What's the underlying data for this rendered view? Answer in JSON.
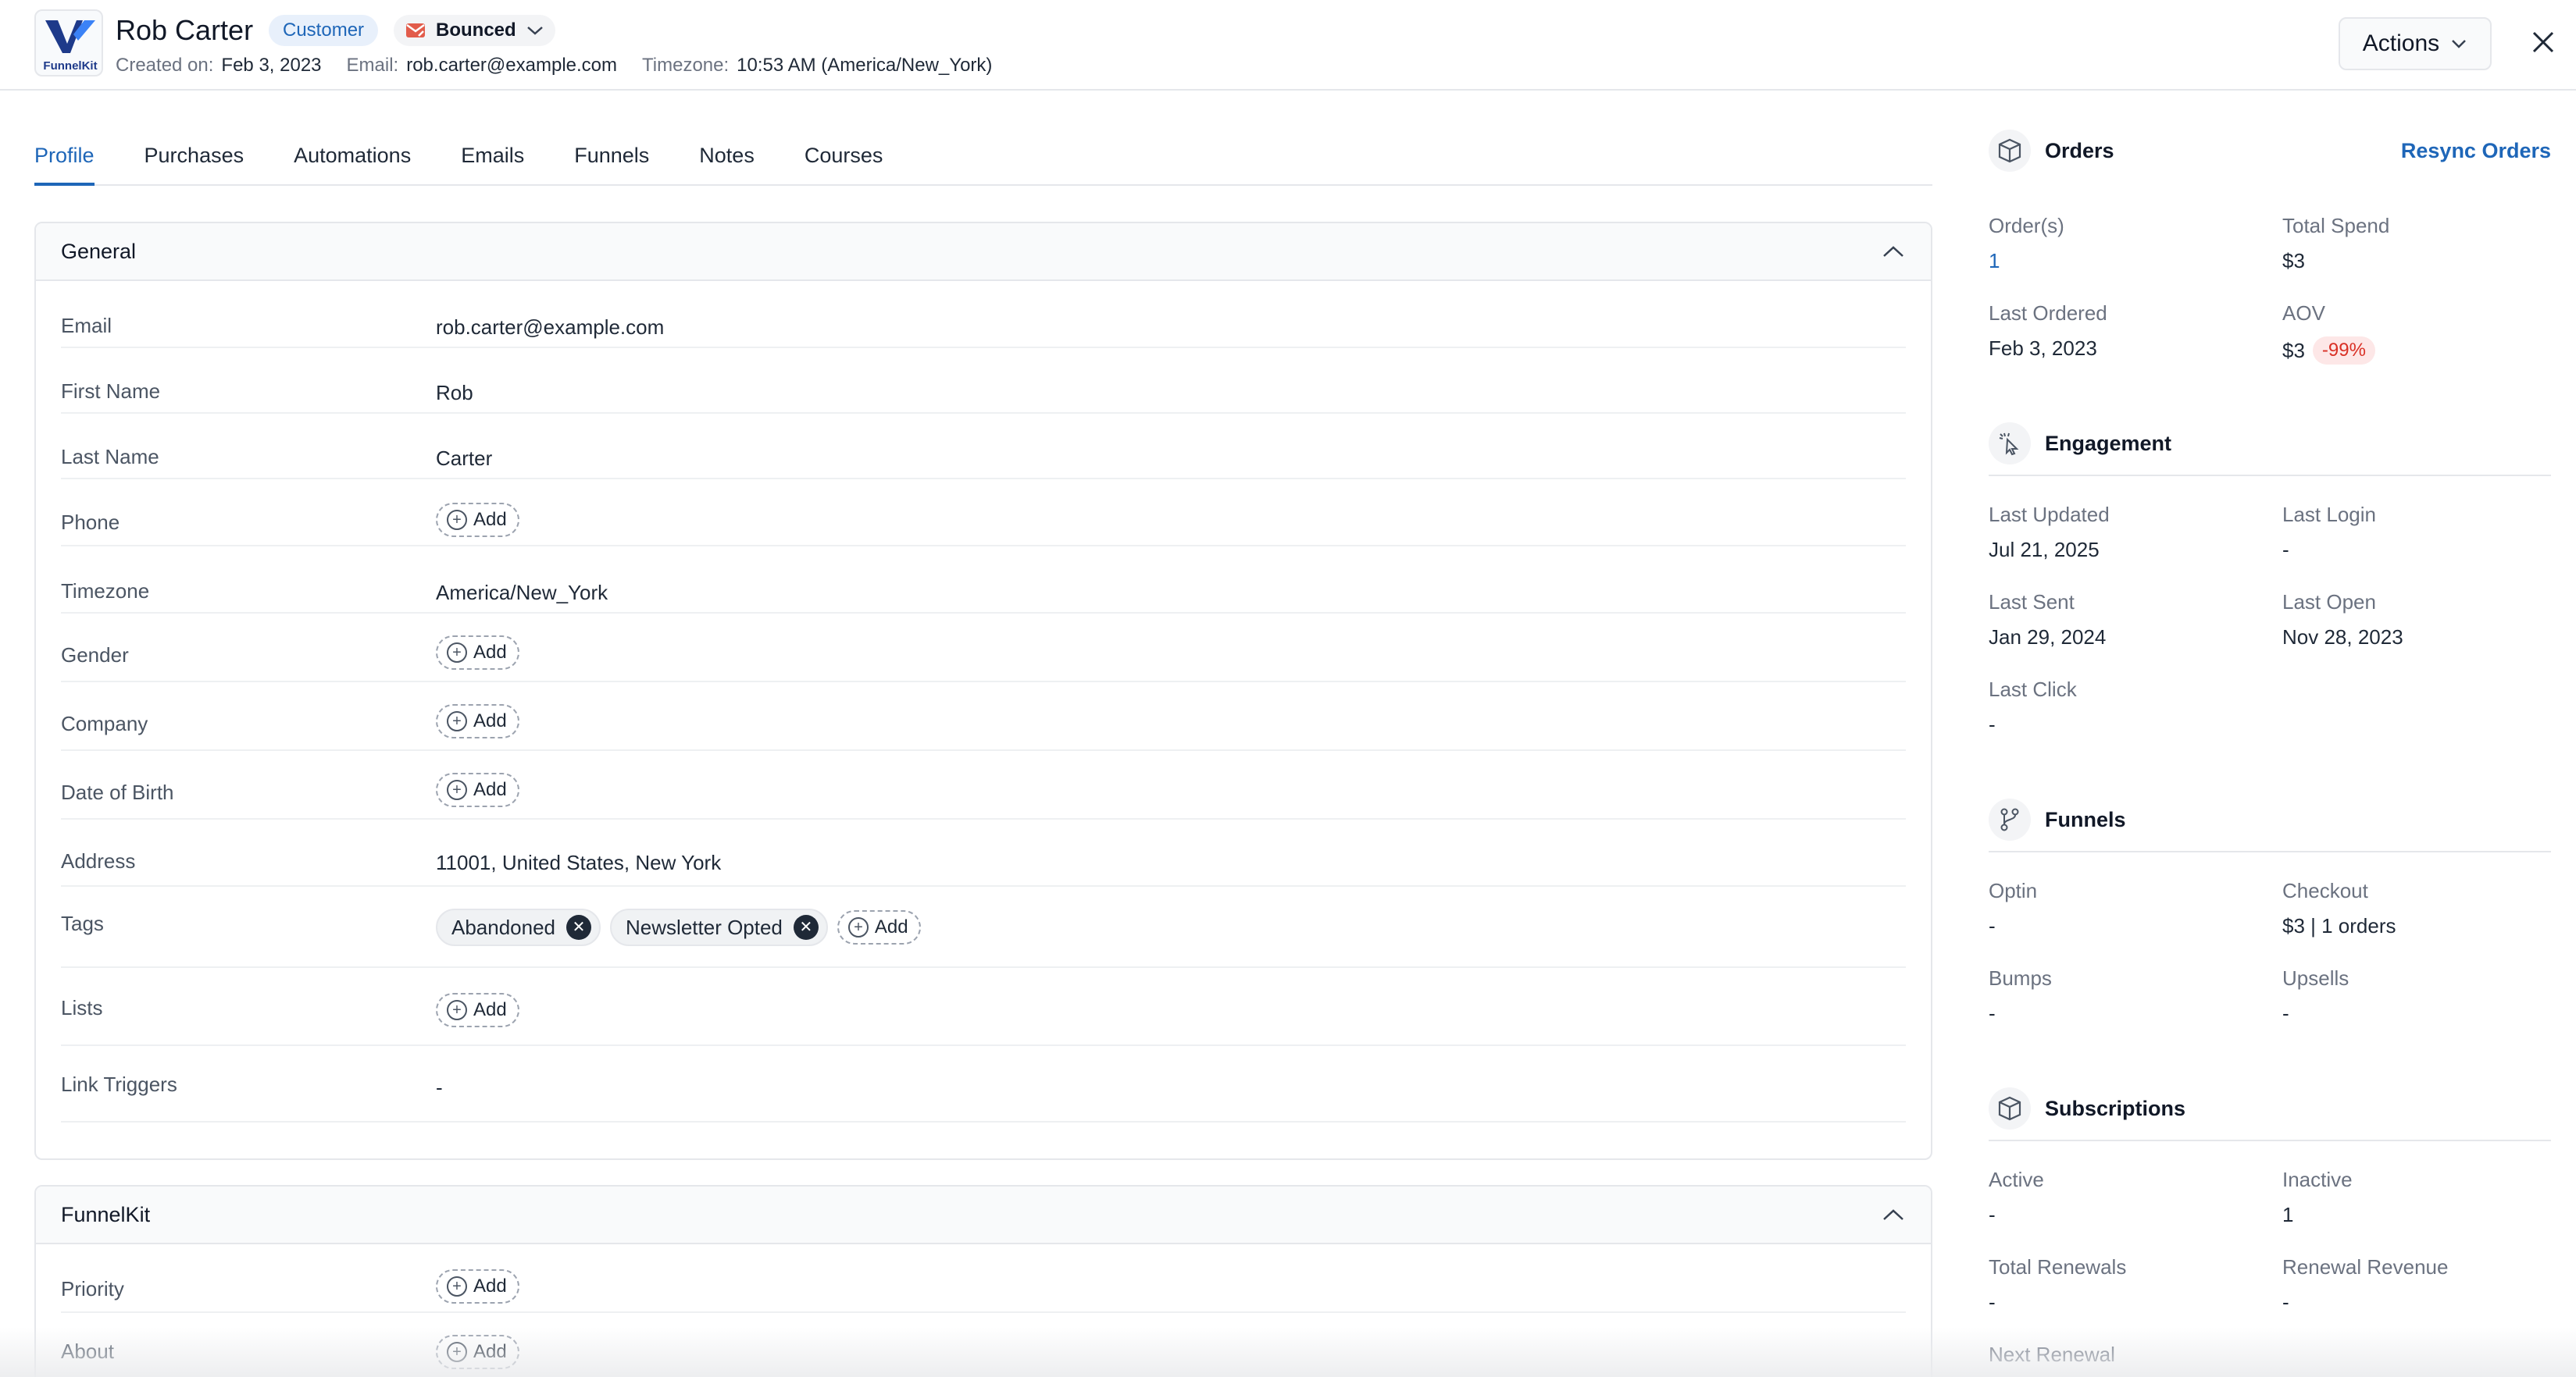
{
  "header": {
    "logo_text": "FunnelKit",
    "name": "Rob Carter",
    "customer_badge": "Customer",
    "status": "Bounced",
    "created_label": "Created on:",
    "created_value": "Feb 3, 2023",
    "email_label": "Email:",
    "email_value": "rob.carter@example.com",
    "timezone_label": "Timezone:",
    "timezone_value": "10:53 AM (America/New_York)",
    "actions_label": "Actions"
  },
  "tabs": [
    "Profile",
    "Purchases",
    "Automations",
    "Emails",
    "Funnels",
    "Notes",
    "Courses"
  ],
  "add_label": "Add",
  "general": {
    "title": "General",
    "rows": {
      "email": {
        "label": "Email",
        "value": "rob.carter@example.com"
      },
      "first_name": {
        "label": "First Name",
        "value": "Rob"
      },
      "last_name": {
        "label": "Last Name",
        "value": "Carter"
      },
      "phone": {
        "label": "Phone"
      },
      "timezone": {
        "label": "Timezone",
        "value": "America/New_York"
      },
      "gender": {
        "label": "Gender"
      },
      "company": {
        "label": "Company"
      },
      "dob": {
        "label": "Date of Birth"
      },
      "address": {
        "label": "Address",
        "value": "11001, United States, New York"
      },
      "tags": {
        "label": "Tags",
        "items": [
          "Abandoned",
          "Newsletter Opted"
        ]
      },
      "lists": {
        "label": "Lists"
      },
      "link_triggers": {
        "label": "Link Triggers",
        "value": "-"
      }
    }
  },
  "funnelkit": {
    "title": "FunnelKit",
    "rows": {
      "priority": {
        "label": "Priority"
      },
      "about": {
        "label": "About"
      }
    }
  },
  "orders": {
    "title": "Orders",
    "resync_label": "Resync Orders",
    "orders_label": "Order(s)",
    "orders_value": "1",
    "total_spend_label": "Total Spend",
    "total_spend_value": "$3",
    "last_ordered_label": "Last Ordered",
    "last_ordered_value": "Feb 3, 2023",
    "aov_label": "AOV",
    "aov_value": "$3",
    "aov_change": "-99%"
  },
  "engagement": {
    "title": "Engagement",
    "last_updated_label": "Last Updated",
    "last_updated_value": "Jul 21, 2025",
    "last_login_label": "Last Login",
    "last_login_value": "-",
    "last_sent_label": "Last Sent",
    "last_sent_value": "Jan 29, 2024",
    "last_open_label": "Last Open",
    "last_open_value": "Nov 28, 2023",
    "last_click_label": "Last Click",
    "last_click_value": "-"
  },
  "funnels_panel": {
    "title": "Funnels",
    "optin_label": "Optin",
    "optin_value": "-",
    "checkout_label": "Checkout",
    "checkout_value": "$3 | 1 orders",
    "bumps_label": "Bumps",
    "bumps_value": "-",
    "upsells_label": "Upsells",
    "upsells_value": "-"
  },
  "subscriptions": {
    "title": "Subscriptions",
    "active_label": "Active",
    "active_value": "-",
    "inactive_label": "Inactive",
    "inactive_value": "1",
    "total_renewals_label": "Total Renewals",
    "total_renewals_value": "-",
    "renewal_revenue_label": "Renewal Revenue",
    "renewal_revenue_value": "-",
    "next_renewal_label": "Next Renewal"
  },
  "colors": {
    "accent": "#1e66b8",
    "badge_bg": "#e8f0fb",
    "negative": "#d93025"
  }
}
